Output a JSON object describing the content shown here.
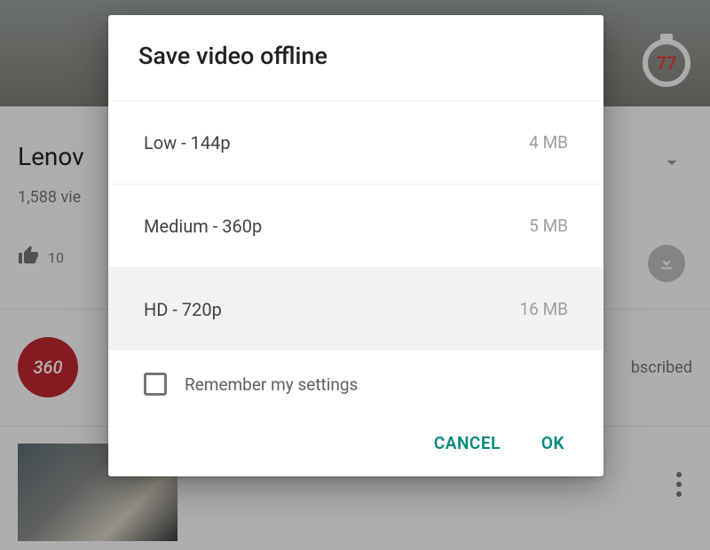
{
  "background": {
    "title_truncated": "Lenov",
    "views_truncated": "1,588 vie",
    "like_count": "10",
    "chip_text": "360",
    "subscribed_truncated": "bscribed",
    "stopwatch_value": "77"
  },
  "dialog": {
    "title": "Save video offline",
    "options": [
      {
        "label": "Low - 144p",
        "size": "4 MB",
        "selected": false
      },
      {
        "label": "Medium - 360p",
        "size": "5 MB",
        "selected": false
      },
      {
        "label": "HD - 720p",
        "size": "16 MB",
        "selected": true
      }
    ],
    "remember_label": "Remember my settings",
    "remember_checked": false,
    "cancel_label": "CANCEL",
    "ok_label": "OK"
  }
}
